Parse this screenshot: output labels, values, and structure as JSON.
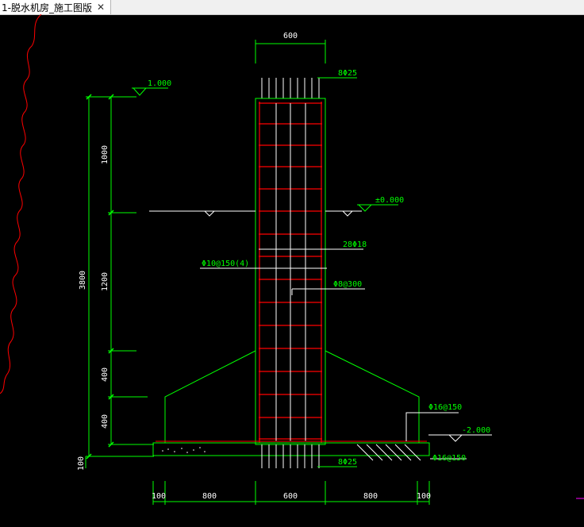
{
  "tab": {
    "title": "1-脱水机房_施工图版",
    "close_icon": "close-icon"
  },
  "drawing": {
    "colors": {
      "green": "#00ff00",
      "red": "#ff0000",
      "white": "#ffffff",
      "background": "#000000"
    },
    "dim_top_width": "600",
    "dim_left_total": "3800",
    "dim_left_segments": [
      "1000",
      "1200",
      "400",
      "400",
      "100"
    ],
    "dim_bottom_segments": [
      "100",
      "800",
      "600",
      "800",
      "100"
    ],
    "label_top_rebar": "8Φ25",
    "label_bottom_rebar": "8Φ25",
    "label_main_rebar": "28Φ18",
    "label_stirrup": "Φ10@150(4)",
    "label_tie": "Φ8@300",
    "label_slab_top": "Φ16@150",
    "label_slab_bottom": "Φ16@150",
    "elevation_top": "1.000",
    "elevation_ground": "±0.000",
    "elevation_base": "-2.000"
  }
}
